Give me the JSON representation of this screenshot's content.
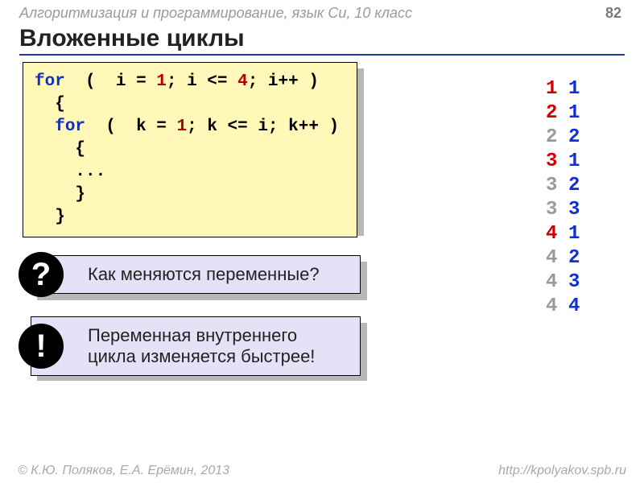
{
  "header": {
    "course": "Алгоритмизация и программирование, язык Си, 10 класс",
    "page": "82"
  },
  "title": "Вложенные циклы",
  "code": {
    "kw_for_a": "for",
    "open_a": "(",
    "init_a": "i = ",
    "one_a": "1",
    "cond_a": "; i <= ",
    "lim_a": "4",
    "step_a": "; i++ )",
    "brace_open_a": "{",
    "kw_for_b": "for",
    "open_b": "(",
    "init_b": "k = ",
    "one_b": "1",
    "cond_close_b": "; k <= i; k++ )",
    "brace_open_b": "{",
    "body": "...",
    "brace_close_b": "}",
    "brace_close_a": "}"
  },
  "callouts": {
    "q_symbol": "?",
    "q_text": "Как меняются переменные?",
    "e_symbol": "!",
    "e_text": "Переменная внутреннего цикла изменяется быстрее!"
  },
  "output": [
    {
      "i": "1",
      "k": "1",
      "ic": "red",
      "kc": "blue"
    },
    {
      "i": "2",
      "k": "1",
      "ic": "red",
      "kc": "blue"
    },
    {
      "i": "2",
      "k": "2",
      "ic": "gray",
      "kc": "blue"
    },
    {
      "i": "3",
      "k": "1",
      "ic": "red",
      "kc": "blue"
    },
    {
      "i": "3",
      "k": "2",
      "ic": "gray",
      "kc": "blue"
    },
    {
      "i": "3",
      "k": "3",
      "ic": "gray",
      "kc": "blue"
    },
    {
      "i": "4",
      "k": "1",
      "ic": "red",
      "kc": "blue"
    },
    {
      "i": "4",
      "k": "2",
      "ic": "gray",
      "kc": "blue"
    },
    {
      "i": "4",
      "k": "3",
      "ic": "gray",
      "kc": "blue"
    },
    {
      "i": "4",
      "k": "4",
      "ic": "gray",
      "kc": "blue"
    }
  ],
  "footer": {
    "copyright": "© К.Ю. Поляков, Е.А. Ерёмин, 2013",
    "url": "http://kpolyakov.spb.ru"
  }
}
